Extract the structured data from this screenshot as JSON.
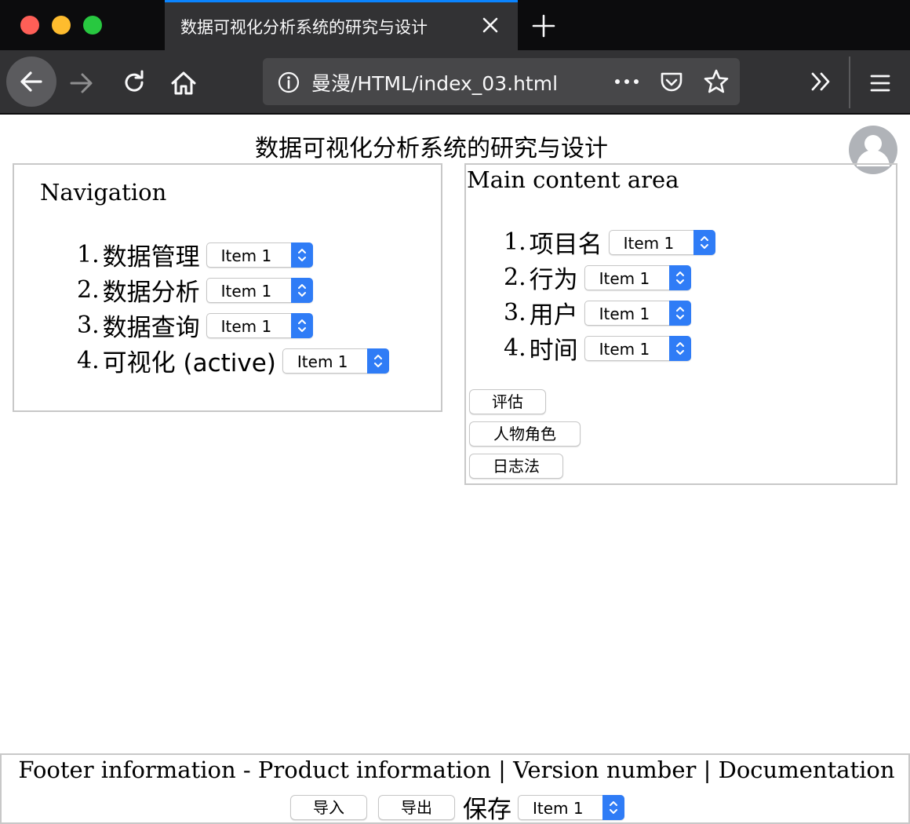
{
  "browser": {
    "tab_title": "数据可视化分析系统的研究与设计",
    "url": "曼漫/HTML/index_03.html"
  },
  "page": {
    "title": "数据可视化分析系统的研究与设计"
  },
  "nav": {
    "heading": "Navigation",
    "items": [
      {
        "num": "1.",
        "label": "数据管理",
        "select": "Item 1"
      },
      {
        "num": "2.",
        "label": "数据分析",
        "select": "Item 1"
      },
      {
        "num": "3.",
        "label": "数据查询",
        "select": "Item 1"
      },
      {
        "num": "4.",
        "label": "可视化 (active)",
        "select": "Item 1"
      }
    ]
  },
  "main": {
    "heading": "Main content area",
    "items": [
      {
        "num": "1.",
        "label": "项目名",
        "select": "Item 1"
      },
      {
        "num": "2.",
        "label": "行为",
        "select": "Item 1"
      },
      {
        "num": "3.",
        "label": "用户",
        "select": "Item 1"
      },
      {
        "num": "4.",
        "label": "时间",
        "select": "Item 1"
      }
    ],
    "buttons": [
      "评估",
      "人物角色",
      "日志法"
    ]
  },
  "footer": {
    "text": "Footer information - Product information | Version number | Documentation",
    "import_label": "导入",
    "export_label": "导出",
    "save_label": "保存",
    "select": "Item 1"
  },
  "colors": {
    "accent": "#0a84ff",
    "select_arrow": "#2f7cf6",
    "chrome_dark": "#0c0c0d",
    "toolbar": "#323234"
  }
}
